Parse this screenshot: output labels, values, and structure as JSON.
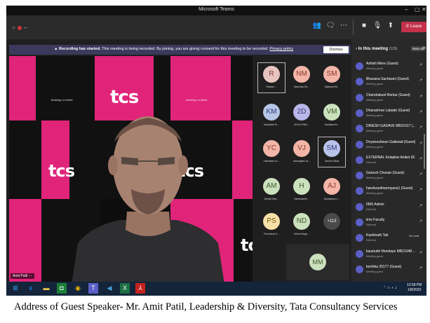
{
  "window": {
    "title": "Microsoft Teams"
  },
  "toolbar": {
    "timer": "--",
    "leave_label": "Leave",
    "icons": [
      "people-icon",
      "chat-icon",
      "more-icon",
      "camera-icon",
      "mic-icon",
      "share-icon"
    ]
  },
  "banner": {
    "bold_text": "Recording has started.",
    "text": "This meeting is being recorded. By joining, you are giving consent for this meeting to be recorded.",
    "link": "Privacy policy",
    "dismiss": "Dismiss"
  },
  "video": {
    "speaker_name": "Amit Patil",
    "brand_text": "tcs",
    "pink_text_1": "Building on belief",
    "pink_text_2": "Building on belief"
  },
  "gallery": {
    "tiles": [
      {
        "initials": "R",
        "name": "Ramya ...",
        "color": "#e8c4c0",
        "fg": "#7a3b3b",
        "selected": true
      },
      {
        "initials": "NM",
        "name": "Namrata Sh...",
        "color": "#f2b5a8",
        "fg": "#8a3a2a",
        "selected": false
      },
      {
        "initials": "SM",
        "name": "Sajeeya Mi...",
        "color": "#f2b5a8",
        "fg": "#8a3a2a",
        "selected": false
      },
      {
        "initials": "KM",
        "name": "kaustubh M...",
        "color": "#b6c6e6",
        "fg": "#2c3f73",
        "selected": false
      },
      {
        "initials": "2D",
        "name": "20110 Pallu...",
        "color": "#b9b6e8",
        "fg": "#3a3580",
        "selected": false
      },
      {
        "initials": "VM",
        "name": "Vandana M...",
        "color": "#cbe0bd",
        "fg": "#3d5a2b",
        "selected": false
      },
      {
        "initials": "YC",
        "name": "Yashaswi co...",
        "color": "#f2b5a8",
        "fg": "#8a3a2a",
        "selected": false
      },
      {
        "initials": "VJ",
        "name": "vishwajeet Ja...",
        "color": "#f2b5a8",
        "fg": "#8a3a2a",
        "selected": false
      },
      {
        "initials": "SM",
        "name": "Sachin Mhat",
        "color": "#b9c3ea",
        "fg": "#2d3a78",
        "selected": true
      },
      {
        "initials": "AM",
        "name": "Ashish Mor...",
        "color": "#cbe0bd",
        "fg": "#3d5a2b",
        "selected": false
      },
      {
        "initials": "H",
        "name": "harshvardh...",
        "color": "#cbe0bd",
        "fg": "#3d5a2b",
        "selected": false
      },
      {
        "initials": "AJ",
        "name": "Aishwarya J...",
        "color": "#f2b5a8",
        "fg": "#8a3a2a",
        "selected": false
      },
      {
        "initials": "PS",
        "name": "Poornima S...",
        "color": "#f7e0a8",
        "fg": "#7a5a10",
        "selected": false
      },
      {
        "initials": "ND",
        "name": "Neha Dega...",
        "color": "#cbe0bd",
        "fg": "#3d5a2b",
        "selected": false
      },
      {
        "initials": "+113",
        "name": "",
        "color": "#4a4a4a",
        "fg": "#ffffff",
        "selected": false
      }
    ],
    "self_initials": "MM"
  },
  "panel": {
    "title": "In this meeting",
    "count": "(129)",
    "mute_all": "Mute all",
    "participants": [
      {
        "name": "Ashish More (Guest)",
        "role": "Meeting guest"
      },
      {
        "name": "Bhavana Sachwani (Guest)",
        "role": "Meeting guest"
      },
      {
        "name": "Chandrakant Borkar (Guest)",
        "role": "Meeting guest"
      },
      {
        "name": "Dharashree Labade (Guest)",
        "role": "Meeting guest"
      },
      {
        "name": "DINESH GADAVE MB21017 (...",
        "role": "Meeting guest"
      },
      {
        "name": "Dnyaneshwari Gaikwad (Guest)",
        "role": "Meeting guest"
      },
      {
        "name": "EXTERNAL Kolapkar Aniket (R...",
        "role": "External"
      },
      {
        "name": "Ganesh Chavan (Guest)",
        "role": "Meeting guest"
      },
      {
        "name": "harshvardhanmyana1 (Guest)",
        "role": "Meeting guest"
      },
      {
        "name": "IIMS Admin",
        "role": "External"
      },
      {
        "name": "iims Faculty",
        "role": "External"
      },
      {
        "name": "Kashinath Tati",
        "role": "External",
        "status": "On hold"
      },
      {
        "name": "kaustubh Mundaye MB21048 ...",
        "role": "Meeting guest"
      },
      {
        "name": "keshika 20177 (Guest)",
        "role": "Meeting guest"
      }
    ]
  },
  "taskbar": {
    "time": "12:58 PM",
    "date": "1/8/2022"
  },
  "caption": "Address of Guest Speaker- Mr. Amit Patil, Leadership & Diversity, Tata Consultancy Services"
}
